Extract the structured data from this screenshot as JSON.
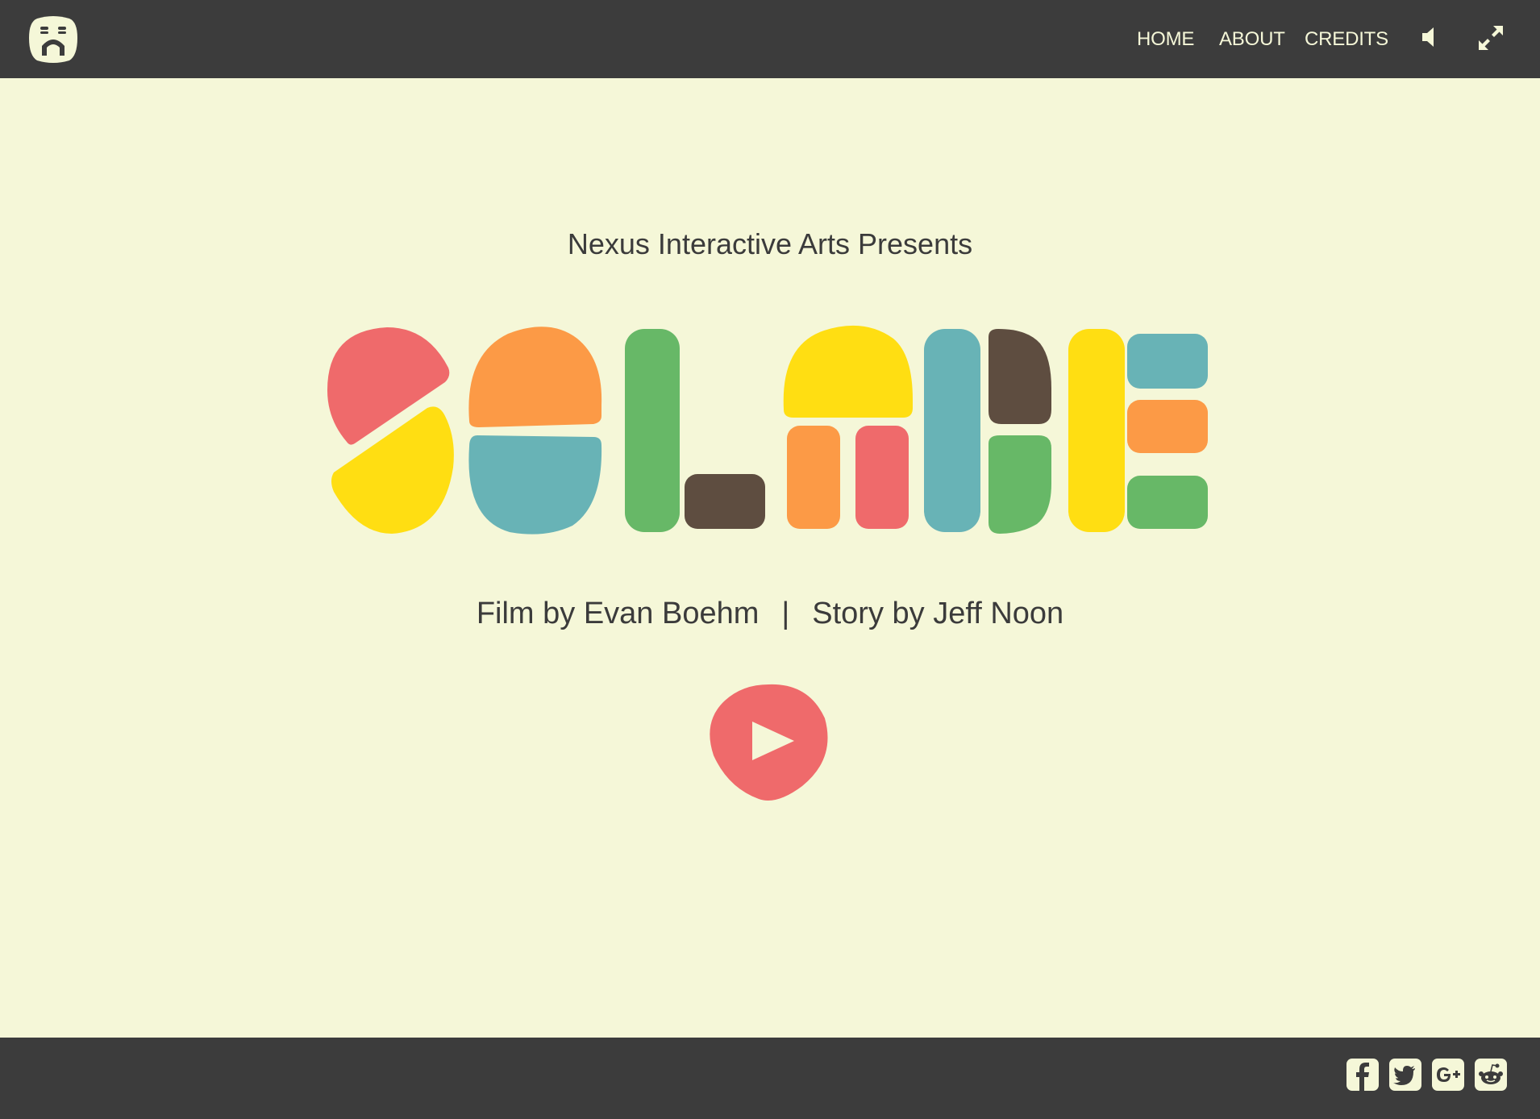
{
  "header": {
    "logo_icon": "robot-face-logo",
    "nav": [
      {
        "label": "HOME"
      },
      {
        "label": "ABOUT"
      },
      {
        "label": "CREDITS"
      }
    ],
    "sound_icon": "speaker-icon",
    "fullscreen_icon": "expand-icon"
  },
  "main": {
    "presenter": "Nexus Interactive Arts Presents",
    "film_credit": "Film by Evan Boehm",
    "separator": "|",
    "story_credit": "Story by Jeff Noon",
    "play_icon": "play-icon"
  },
  "footer": {
    "social": [
      "facebook-icon",
      "twitter-icon",
      "google-plus-icon",
      "reddit-icon"
    ]
  },
  "colors": {
    "bar": "#3c3c3c",
    "background": "#f5f7d8",
    "text": "#3b3b3b",
    "red": "#ef6a6b",
    "orange": "#fc9a46",
    "yellow": "#ffde12",
    "teal": "#68b3b6",
    "green": "#67b867",
    "brown": "#5e4d40"
  }
}
